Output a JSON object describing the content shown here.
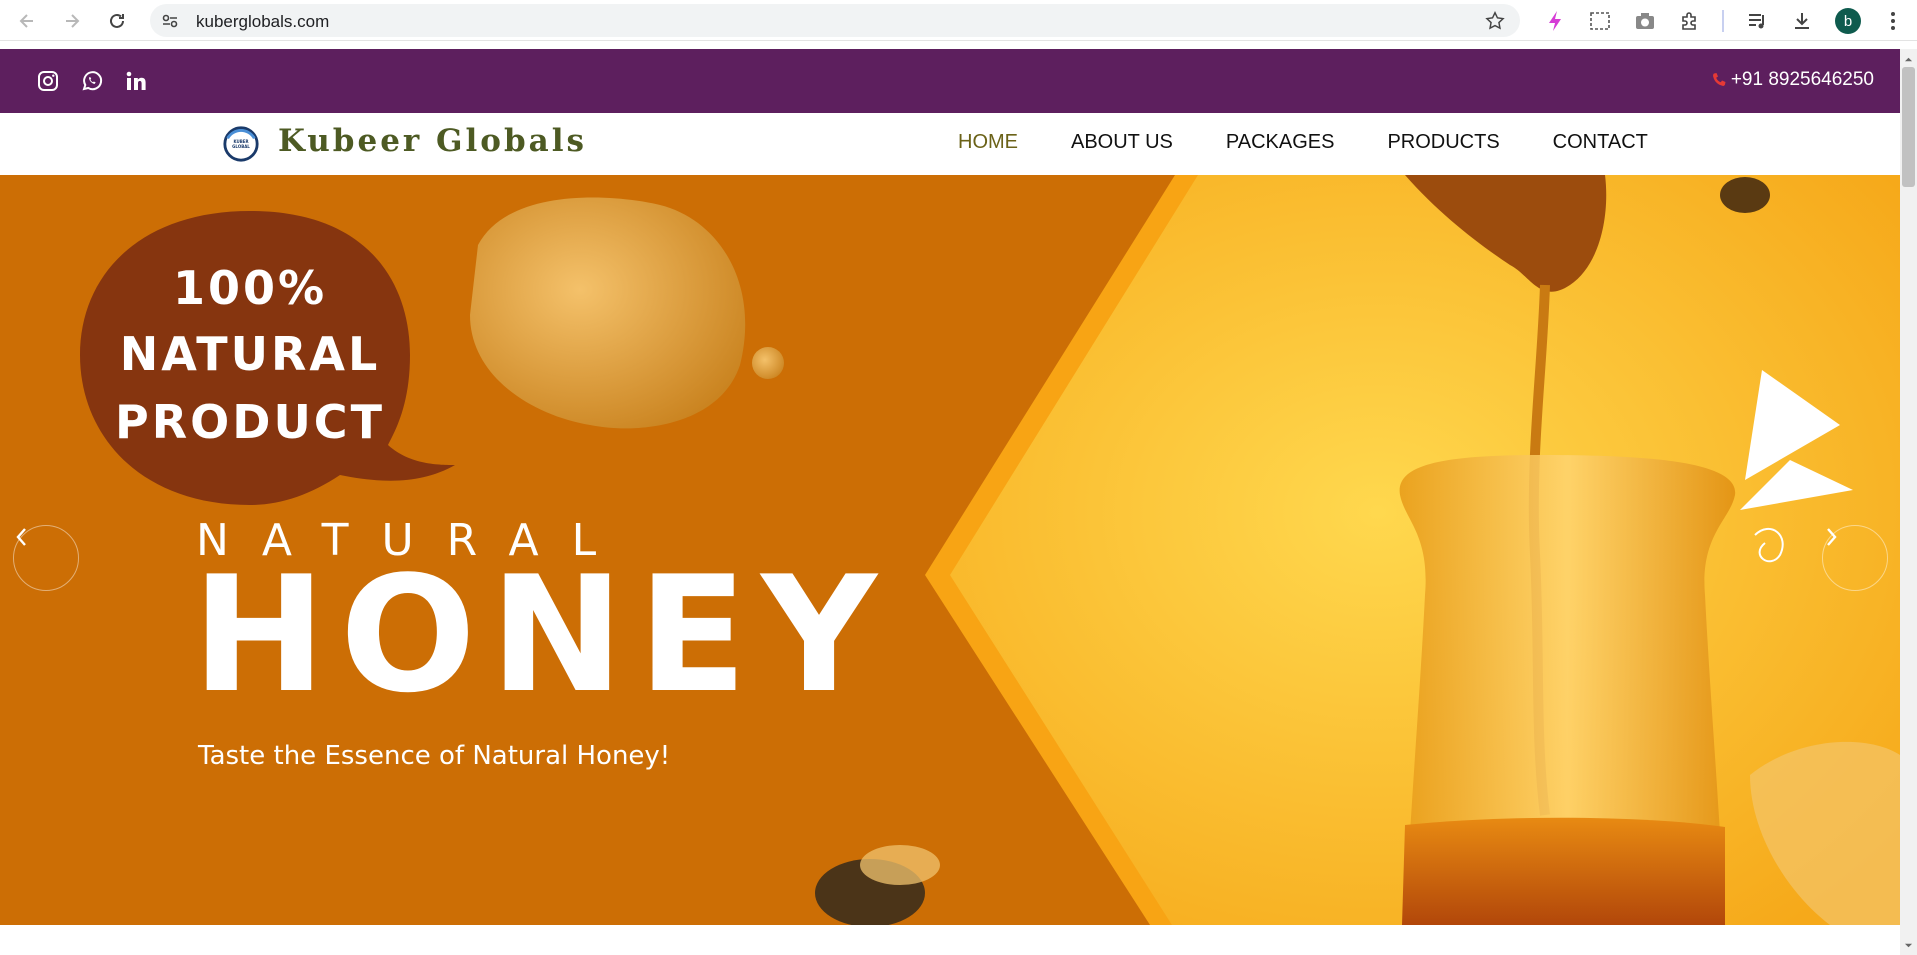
{
  "browser": {
    "url": "kuberglobals.com",
    "profile_initial": "b"
  },
  "topbar": {
    "phone": "+91 8925646250",
    "social_icons": [
      "instagram-icon",
      "whatsapp-icon",
      "linkedin-icon"
    ],
    "bg_color": "#5d1f5e"
  },
  "navbar": {
    "brand": "Kubeer Globals",
    "logo_text": "KUBER GLOBAL",
    "menu": [
      {
        "label": "HOME",
        "active": true
      },
      {
        "label": "ABOUT US",
        "active": false
      },
      {
        "label": "PACKAGES",
        "active": false
      },
      {
        "label": "PRODUCTS",
        "active": false
      },
      {
        "label": "CONTACT",
        "active": false
      }
    ]
  },
  "hero": {
    "badge_line1": "100%",
    "badge_line2": "NATURAL",
    "badge_line3": "PRODUCT",
    "eyebrow": "NATURAL",
    "headline": "HONEY",
    "tagline": "Taste the Essence of Natural Honey!",
    "colors": {
      "orange": "#cc6e05",
      "yellow": "#f8b820",
      "badge": "#86350f"
    }
  }
}
